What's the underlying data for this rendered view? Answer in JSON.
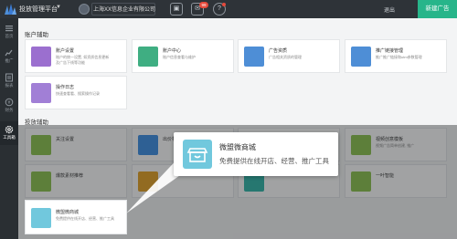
{
  "topbar": {
    "app_title": "投放管理平台",
    "company": "上海XX信息企业有限公司",
    "badge_count": "99",
    "nav_link": "退出",
    "new_ad": "新建广告"
  },
  "sidebar": {
    "items": [
      {
        "label": "首页",
        "icon": "home-icon"
      },
      {
        "label": "推广",
        "icon": "chart-icon"
      },
      {
        "label": "报表",
        "icon": "report-icon"
      },
      {
        "label": "财务",
        "icon": "finance-icon"
      },
      {
        "label": "工具箱",
        "icon": "gear-icon"
      }
    ]
  },
  "sections": {
    "account": "账户辅助",
    "ads": "投放辅助"
  },
  "account_cards": [
    {
      "title": "账户设置",
      "desc1": "账户的统一设置, 如资质信息更新",
      "desc2": "及广告下线等功能",
      "color": "#9b6fcf"
    },
    {
      "title": "账户中心",
      "desc1": "账户信息查看与维护",
      "desc2": "",
      "color": "#3fae82"
    },
    {
      "title": "广告资质",
      "desc1": "广告相关资质的管理",
      "desc2": "",
      "color": "#4e8ed6"
    },
    {
      "title": "推广链接管理",
      "desc1": "推广推广链接和utm参数管理",
      "desc2": "",
      "color": "#4e8ed6"
    },
    {
      "title": "操作日志",
      "desc1": "快速查看看、搜索操作记录",
      "desc2": "",
      "color": "#a17fd6"
    }
  ],
  "ad_cards": [
    {
      "title": "关注设置",
      "desc1": "",
      "color": "#8bc34a"
    },
    {
      "title": "出价相关工具",
      "desc1": "",
      "color": "#3a8ee6"
    },
    {
      "title": "",
      "desc1": "",
      "color": "#e64a4a"
    },
    {
      "title": "视频创意模板",
      "desc1": "视频广告简单创建, 推广",
      "color": "#8bc34a"
    },
    {
      "title": "爆款素材推荐",
      "desc1": "",
      "color": "#8bc34a"
    },
    {
      "title": "",
      "desc1": "",
      "color": "#e5a020"
    },
    {
      "title": "",
      "desc1": "",
      "color": "#2bb5a8"
    },
    {
      "title": "一叶智能",
      "desc1": "",
      "color": "#8bc34a"
    }
  ],
  "highlight": {
    "title": "微盟微商城",
    "desc": "免费提供在线开店、经营、推广工具"
  }
}
